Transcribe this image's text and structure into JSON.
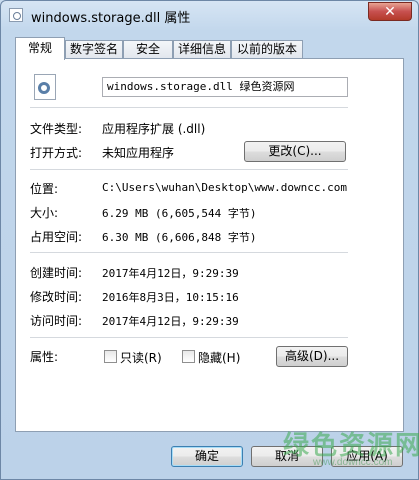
{
  "window": {
    "title": "windows.storage.dll 属性",
    "close_label": "✕"
  },
  "tabs": [
    {
      "label": "常规",
      "active": true
    },
    {
      "label": "数字签名",
      "active": false
    },
    {
      "label": "安全",
      "active": false
    },
    {
      "label": "详细信息",
      "active": false
    },
    {
      "label": "以前的版本",
      "active": false
    }
  ],
  "general": {
    "file_name": "windows.storage.dll 绿色资源网",
    "file_type_label": "文件类型:",
    "file_type_value": "应用程序扩展 (.dll)",
    "opens_with_label": "打开方式:",
    "opens_with_value": "未知应用程序",
    "change_button": "更改(C)...",
    "location_label": "位置:",
    "location_value": "C:\\Users\\wuhan\\Desktop\\www.downcc.com",
    "size_label": "大小:",
    "size_value": "6.29 MB (6,605,544 字节)",
    "size_on_disk_label": "占用空间:",
    "size_on_disk_value": "6.30 MB (6,606,848 字节)",
    "created_label": "创建时间:",
    "created_value": "2017年4月12日，9:29:39",
    "modified_label": "修改时间:",
    "modified_value": "2016年8月3日，10:15:16",
    "accessed_label": "访问时间:",
    "accessed_value": "2017年4月12日，9:29:39",
    "attributes_label": "属性:",
    "readonly_label": "只读(R)",
    "hidden_label": "隐藏(H)",
    "advanced_button": "高级(D)..."
  },
  "footer": {
    "ok_button": "确定",
    "cancel_button": "取消",
    "apply_button": "应用(A)"
  },
  "watermark": {
    "text": "绿色资源网",
    "url": "www.downcc.com"
  }
}
